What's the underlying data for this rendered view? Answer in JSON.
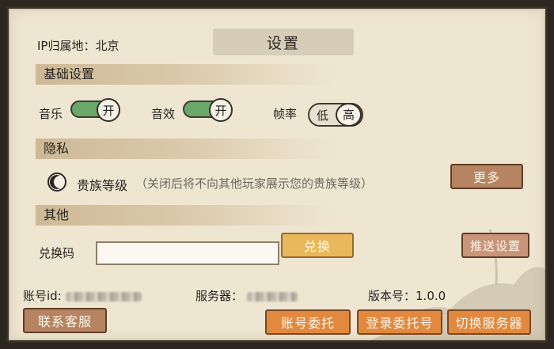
{
  "header": {
    "ip_text": "IP归属地：北京",
    "title": "设置"
  },
  "basic_settings": {
    "section_title": "基础设置",
    "music_label": "音乐",
    "music_toggle": "开",
    "sound_label": "音效",
    "sound_toggle": "开",
    "fps_label": "帧率",
    "fps_options": [
      "低",
      "高"
    ],
    "fps_selected": "高"
  },
  "privacy": {
    "section_title": "隐私",
    "noble_label": "贵族等级",
    "noble_desc": "（关闭后将不向其他玩家展示您的贵族等级）",
    "more_button": "更多"
  },
  "other": {
    "section_title": "其他",
    "redeem_label": "兑换码",
    "redeem_value": "",
    "redeem_button": "兑换",
    "push_button": "推送设置"
  },
  "footer": {
    "account_label": "账号id:",
    "server_label": "服务器：",
    "version_label": "版本号：",
    "version_value": "1.0.0",
    "buttons": {
      "contact": "联系客服",
      "account_entrust": "账号委托",
      "login_entrust": "登录委托号",
      "switch_server": "切换服务器"
    }
  },
  "colors": {
    "panel_bg": "#efe6d2",
    "toggle_on": "#6aa86a",
    "button_orange": "#e0893f",
    "button_gold": "#e9b85c",
    "button_tan": "#b78462"
  }
}
